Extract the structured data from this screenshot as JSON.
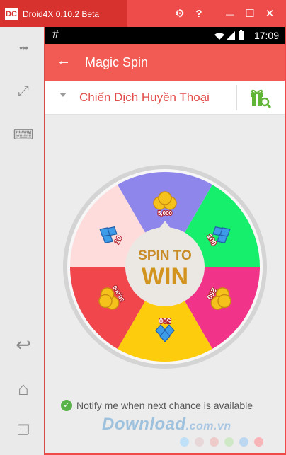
{
  "window": {
    "logo": "DC",
    "title": "Droid4X 0.10.2 Beta",
    "buttons": [
      {
        "name": "settings-gear-button",
        "icon": "gear-icon",
        "glyph": "⚙"
      },
      {
        "name": "help-button",
        "icon": "help-icon",
        "glyph": "?"
      },
      {
        "name": "minimize-button",
        "icon": "minimize-icon",
        "glyph": "—"
      },
      {
        "name": "maximize-button",
        "icon": "maximize-icon",
        "glyph": "☐"
      },
      {
        "name": "close-button",
        "icon": "close-icon",
        "glyph": "✕"
      }
    ]
  },
  "sidebar": {
    "items": [
      {
        "name": "more-options-icon",
        "glyph": "•••"
      },
      {
        "name": "fullscreen-icon",
        "glyph": "⤢"
      },
      {
        "name": "keyboard-icon",
        "glyph": "⌨"
      },
      {
        "name": "back-nav-icon",
        "glyph": "↩"
      },
      {
        "name": "home-icon",
        "glyph": "⌂"
      },
      {
        "name": "recent-apps-icon",
        "glyph": "❐"
      }
    ]
  },
  "statusbar": {
    "notification": "#",
    "time": "17:09"
  },
  "toolbar": {
    "back": "←",
    "title": "Magic Spin"
  },
  "campaign": {
    "selected": "Chiến Dịch Huyền Thoại"
  },
  "wheel": {
    "center_line1": "SPIN TO",
    "center_line2": "WIN",
    "segments": [
      {
        "label": "5,000",
        "color": "#8f86ec",
        "prize": "coins"
      },
      {
        "label": "100",
        "color": "#16ef6b",
        "prize": "gems"
      },
      {
        "label": "250",
        "color": "#f2338a",
        "prize": "coins"
      },
      {
        "label": "500",
        "color": "#fdcc0c",
        "prize": "gems"
      },
      {
        "label": "50,000",
        "color": "#f0464c",
        "prize": "coins"
      },
      {
        "label": "10",
        "color": "#ffdcdc",
        "prize": "gems"
      }
    ]
  },
  "notify": {
    "checked": true,
    "text": "Notify me when next chance is available"
  },
  "watermark": {
    "text": "Download",
    "suffix": ".com.vn",
    "dots": [
      "#bfe0f6",
      "#e8d7d8",
      "#eecbc8",
      "#cfe9c6",
      "#bcd7f1",
      "#f8b5b8"
    ]
  }
}
